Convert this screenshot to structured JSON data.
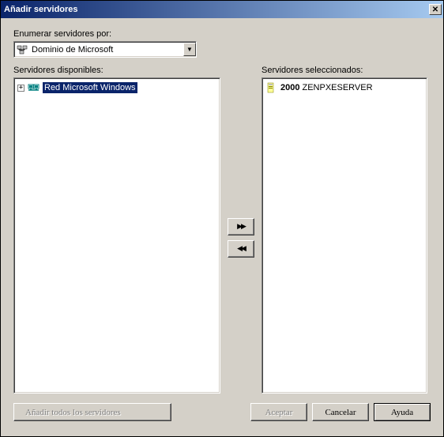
{
  "title": "Añadir servidores",
  "enumerate_label": "Enumerar servidores por:",
  "dropdown_value": "Dominio de Microsoft",
  "available_label": "Servidores disponibles:",
  "selected_label": "Servidores seleccionados:",
  "available_items": [
    {
      "label": "Red Microsoft Windows",
      "selected": true
    }
  ],
  "selected_items": [
    {
      "badge": "2000",
      "label": "ZENPXESERVER"
    }
  ],
  "buttons": {
    "add_all": "Añadir todos los servidores",
    "accept": "Aceptar",
    "cancel": "Cancelar",
    "help": "Ayuda"
  }
}
